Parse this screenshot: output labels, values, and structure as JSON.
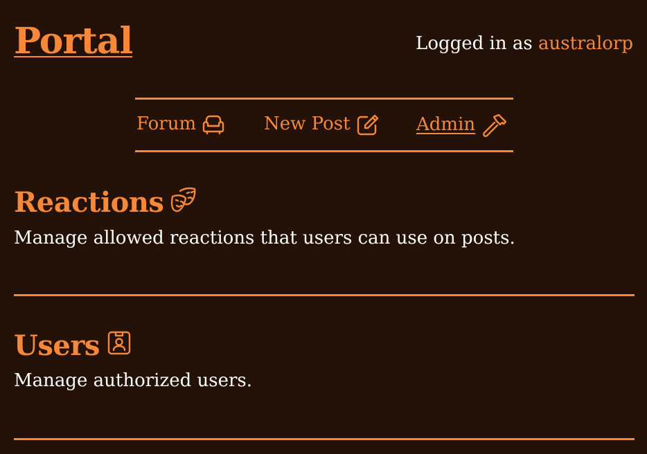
{
  "header": {
    "site_title": "Portal",
    "logged_in_prefix": "Logged in as",
    "username": "australorp"
  },
  "nav": {
    "items": [
      {
        "label": "Forum",
        "icon": "sofa-icon"
      },
      {
        "label": "New Post",
        "icon": "edit-icon"
      },
      {
        "label": "Admin",
        "icon": "hammer-icon",
        "active": true
      }
    ]
  },
  "sections": [
    {
      "title": "Reactions",
      "icon": "masks-theater-icon",
      "description": "Manage allowed reactions that users can use on posts."
    },
    {
      "title": "Users",
      "icon": "id-badge-icon",
      "description": "Manage authorized users."
    }
  ],
  "colors": {
    "background": "#241108",
    "accent": "#f5883a",
    "text": "#ffffff"
  }
}
